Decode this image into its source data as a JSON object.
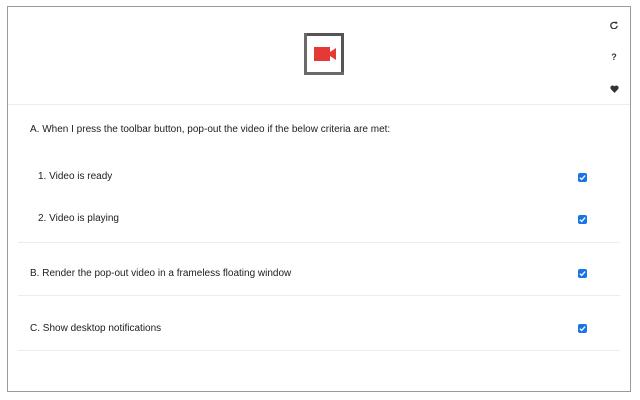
{
  "header": {
    "logo_icon": "video-camera-icon",
    "actions": [
      {
        "icon": "refresh-icon"
      },
      {
        "label": "?"
      },
      {
        "icon": "heart-icon"
      }
    ]
  },
  "settings": {
    "section_a_title": "A. When I press the toolbar button, pop-out the video if the below criteria are met:",
    "items": [
      {
        "label": "1. Video is ready",
        "checked": true
      },
      {
        "label": "2. Video is playing",
        "checked": true
      },
      {
        "label": "B. Render the pop-out video in a frameless floating window",
        "checked": true
      },
      {
        "label": "C. Show desktop notifications",
        "checked": true
      }
    ]
  },
  "colors": {
    "accent": "#1a73e8",
    "logo_red": "#e53935",
    "logo_frame": "#555555"
  }
}
